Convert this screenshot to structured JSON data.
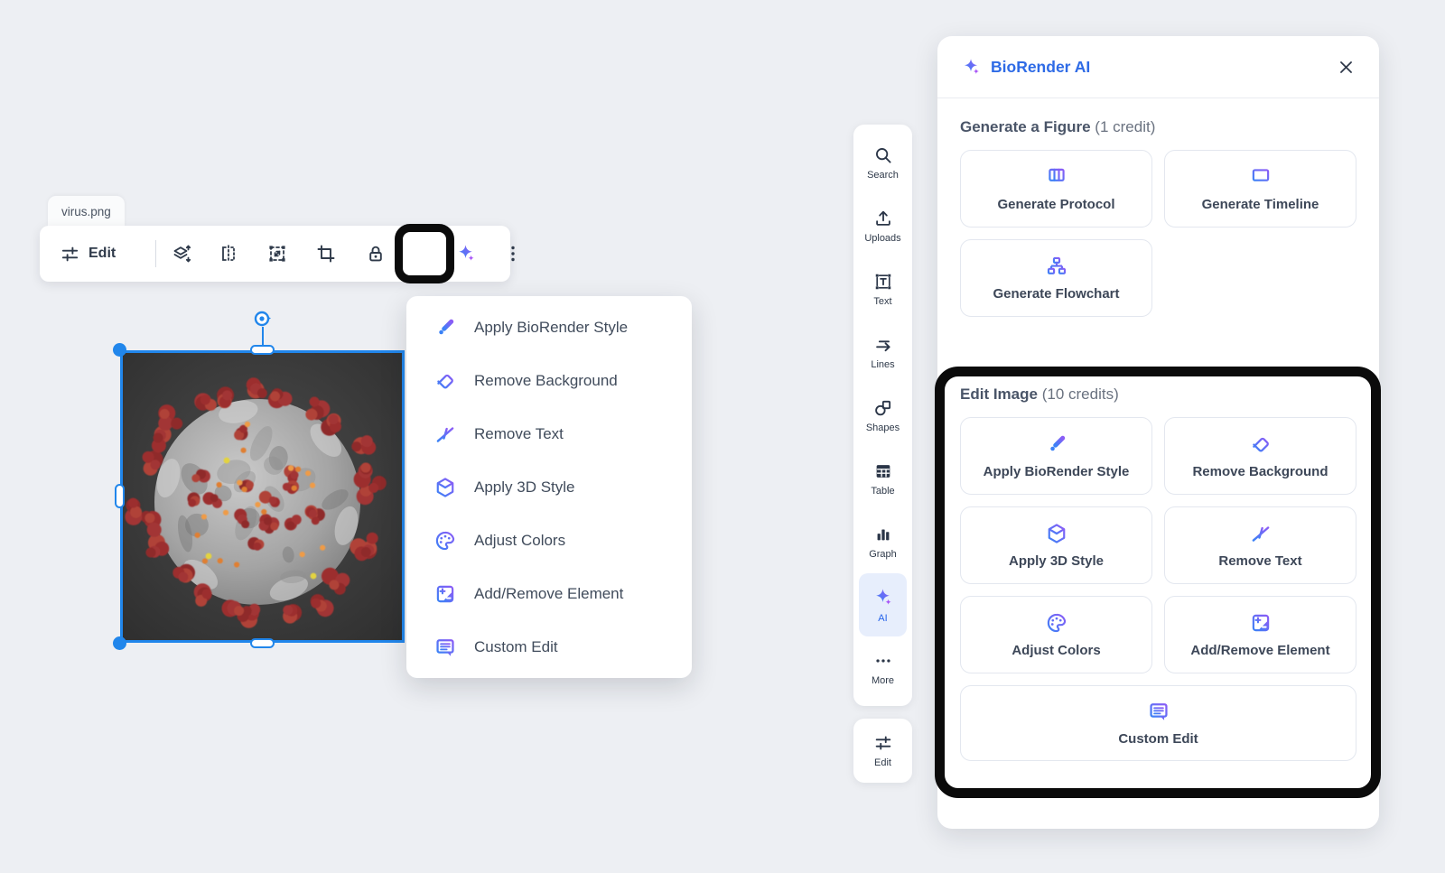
{
  "canvas": {
    "file_label": "virus.png",
    "image_alt": "coronavirus-3d-illustration"
  },
  "toolbar": {
    "edit_label": "Edit",
    "icons": [
      "adjust-sliders-icon",
      "layers-order-icon",
      "flip-horizontal-icon",
      "transform-icon",
      "crop-icon",
      "lock-icon",
      "ai-sparkles-icon",
      "more-options-icon"
    ]
  },
  "context_menu": {
    "items": [
      {
        "label": "Apply BioRender Style",
        "icon": "paintbrush-icon"
      },
      {
        "label": "Remove Background",
        "icon": "eraser-icon"
      },
      {
        "label": "Remove Text",
        "icon": "remove-text-icon"
      },
      {
        "label": "Apply 3D Style",
        "icon": "cube-3d-icon"
      },
      {
        "label": "Adjust Colors",
        "icon": "palette-icon"
      },
      {
        "label": "Add/Remove Element",
        "icon": "add-remove-image-icon"
      },
      {
        "label": "Custom Edit",
        "icon": "comment-edit-icon"
      }
    ]
  },
  "sidebar": {
    "items": [
      {
        "label": "Search",
        "icon": "search-icon",
        "active": false
      },
      {
        "label": "Uploads",
        "icon": "upload-icon",
        "active": false
      },
      {
        "label": "Text",
        "icon": "text-tool-icon",
        "active": false
      },
      {
        "label": "Lines",
        "icon": "lines-arrow-icon",
        "active": false
      },
      {
        "label": "Shapes",
        "icon": "shapes-icon",
        "active": false
      },
      {
        "label": "Table",
        "icon": "table-icon",
        "active": false
      },
      {
        "label": "Graph",
        "icon": "graph-icon",
        "active": false
      },
      {
        "label": "AI",
        "icon": "ai-sparkles-icon",
        "active": true
      },
      {
        "label": "More",
        "icon": "more-dots-icon",
        "active": false
      }
    ],
    "edit_item": {
      "label": "Edit",
      "icon": "adjust-sliders-icon"
    }
  },
  "ai_panel": {
    "title": "BioRender AI",
    "generate_section": {
      "title": "Generate a Figure",
      "credits": "(1 credit)",
      "buttons": [
        {
          "label": "Generate Protocol",
          "icon": "protocol-columns-icon"
        },
        {
          "label": "Generate Timeline",
          "icon": "timeline-monitor-icon"
        },
        {
          "label": "Generate Flowchart",
          "icon": "flowchart-icon"
        }
      ]
    },
    "edit_section": {
      "title": "Edit Image",
      "credits": "(10 credits)",
      "buttons": [
        {
          "label": "Apply BioRender Style",
          "icon": "paintbrush-icon"
        },
        {
          "label": "Remove Background",
          "icon": "eraser-icon"
        },
        {
          "label": "Apply 3D Style",
          "icon": "cube-3d-icon"
        },
        {
          "label": "Remove Text",
          "icon": "remove-text-icon"
        },
        {
          "label": "Adjust Colors",
          "icon": "palette-icon"
        },
        {
          "label": "Add/Remove Element",
          "icon": "add-remove-image-icon"
        },
        {
          "label": "Custom Edit",
          "icon": "comment-edit-icon"
        }
      ]
    }
  },
  "colors": {
    "accent_blue": "#2e6be6",
    "icon_gradient_start": "#8b5cf6",
    "icon_gradient_end": "#3b82f6",
    "selection_blue": "#2186eb",
    "annotation_black": "#0b0b0b",
    "sidebar_active_bg": "#e7eefc"
  }
}
